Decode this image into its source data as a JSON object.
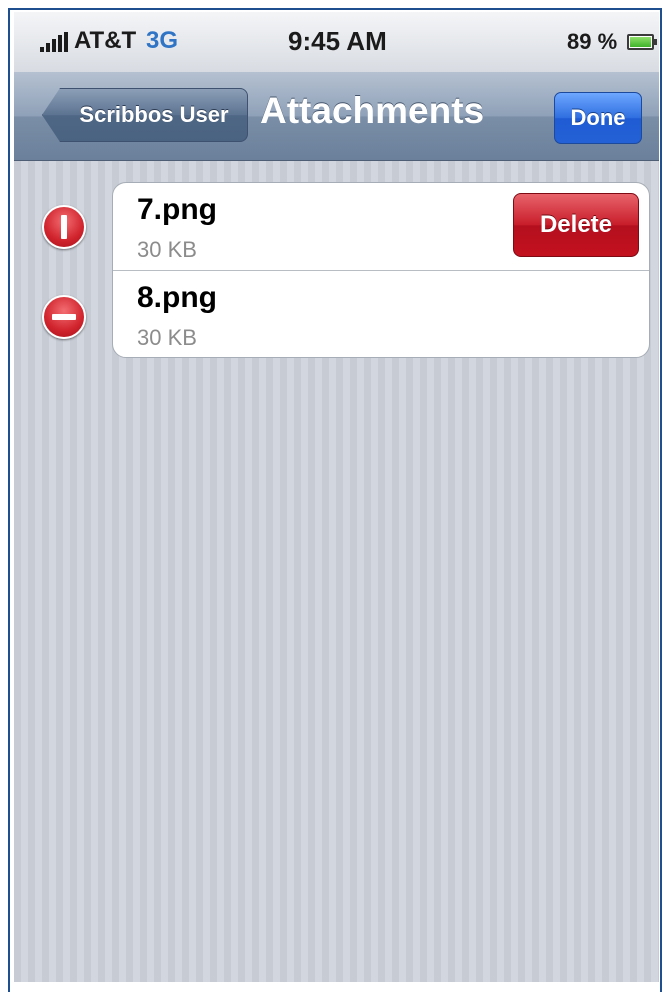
{
  "status_bar": {
    "carrier": "AT&T",
    "network": "3G",
    "time": "9:45 AM",
    "battery_percent": "89 %",
    "signal_icon": "signal-bars-icon",
    "battery_icon": "battery-icon"
  },
  "nav_bar": {
    "back_label": "Scribbos User",
    "title": "Attachments",
    "done_label": "Done"
  },
  "attachments": [
    {
      "name": "7.png",
      "size": "30 KB",
      "delete_confirm_visible": true,
      "delete_label": "Delete"
    },
    {
      "name": "8.png",
      "size": "30 KB",
      "delete_confirm_visible": false
    }
  ],
  "colors": {
    "nav_bar": "#7a8ea7",
    "done_button": "#2461d6",
    "delete_button": "#c3111f",
    "network_label": "#2f74c5"
  }
}
